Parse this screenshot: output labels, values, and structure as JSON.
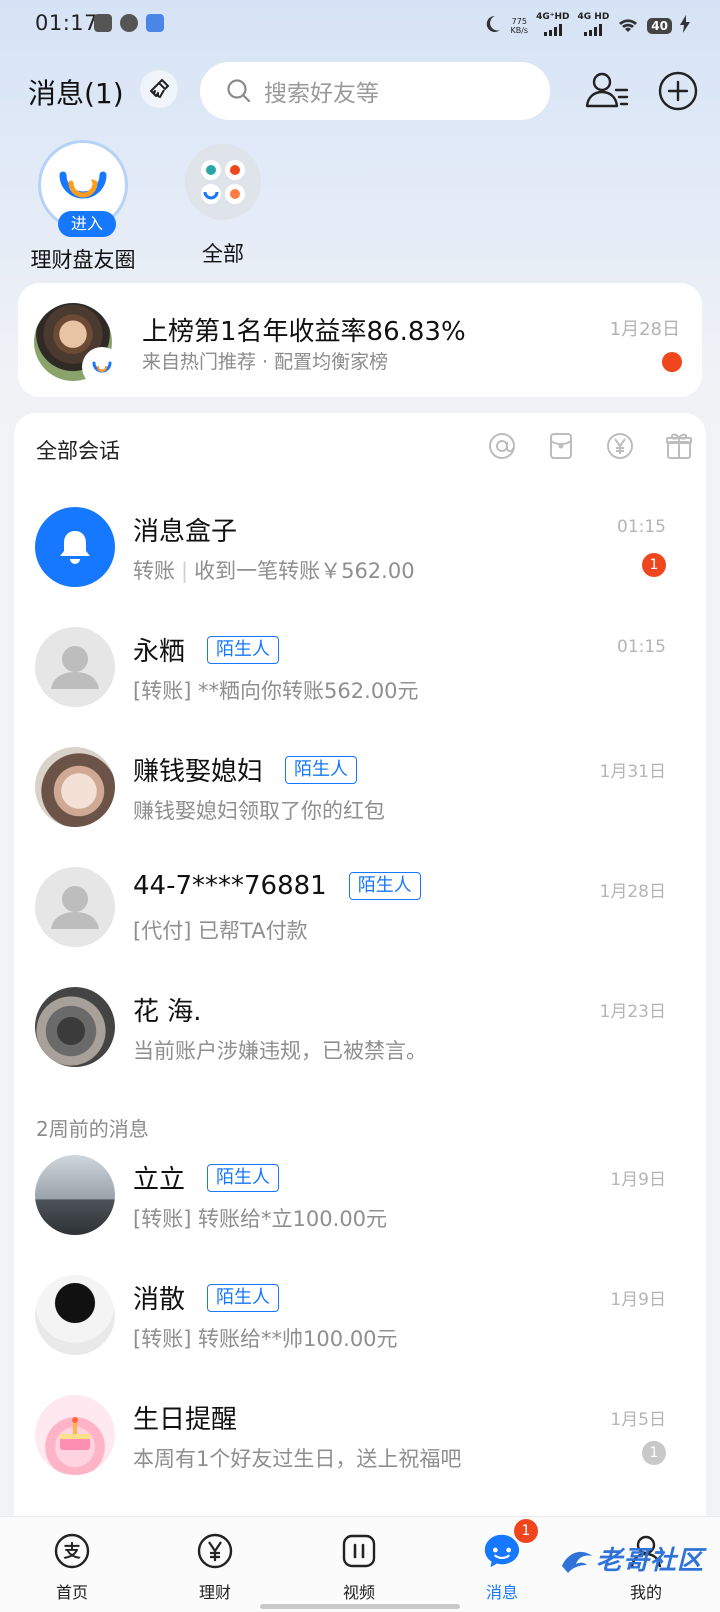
{
  "status_bar": {
    "time": "01:17",
    "speed_value": "775",
    "speed_unit": "KB/s",
    "net1": "4G⁺HD",
    "net2": "4G HD",
    "battery": "40"
  },
  "header": {
    "title": "消息(1)",
    "search_placeholder": "搜索好友等"
  },
  "circles": [
    {
      "label": "理财盘友圈",
      "badge": "进入"
    },
    {
      "label": "全部"
    }
  ],
  "promo": {
    "title": "上榜第1名年收益率86.83%",
    "subtitle": "来自热门推荐 · 配置均衡家榜",
    "date": "1月28日"
  },
  "conversations_header": "全部会话",
  "conversations": [
    {
      "name": "消息盒子",
      "tag": "",
      "msg_prefix": "转账",
      "msg": "收到一笔转账￥562.00",
      "time": "01:15",
      "badge": "1"
    },
    {
      "name": "永粞",
      "tag": "陌生人",
      "msg": "[转账] **粞向你转账562.00元",
      "time": "01:15"
    },
    {
      "name": "赚钱娶媳妇",
      "tag": "陌生人",
      "msg": "赚钱娶媳妇领取了你的红包",
      "time": "1月31日"
    },
    {
      "name": "44-7****76881",
      "tag": "陌生人",
      "msg": "[代付] 已帮TA付款",
      "time": "1月28日"
    },
    {
      "name": "花 海.",
      "tag": "",
      "msg": "当前账户涉嫌违规，已被禁言。",
      "time": "1月23日"
    }
  ],
  "older_section_label": "2周前的消息",
  "older_conversations": [
    {
      "name": "立立",
      "tag": "陌生人",
      "msg": "[转账] 转账给*立100.00元",
      "time": "1月9日"
    },
    {
      "name": "消散",
      "tag": "陌生人",
      "msg": "[转账] 转账给**帅100.00元",
      "time": "1月9日"
    },
    {
      "name": "生日提醒",
      "tag": "",
      "msg": "本周有1个好友过生日，送上祝福吧",
      "time": "1月5日",
      "badge": "1"
    }
  ],
  "tabs": [
    {
      "label": "首页"
    },
    {
      "label": "理财"
    },
    {
      "label": "视频"
    },
    {
      "label": "消息",
      "badge": "1"
    },
    {
      "label": "我的"
    }
  ],
  "watermark": "老哥社区",
  "colors": {
    "accent": "#1677ff",
    "badge_red": "#f0461d",
    "text_grey": "#8f8f8f"
  }
}
